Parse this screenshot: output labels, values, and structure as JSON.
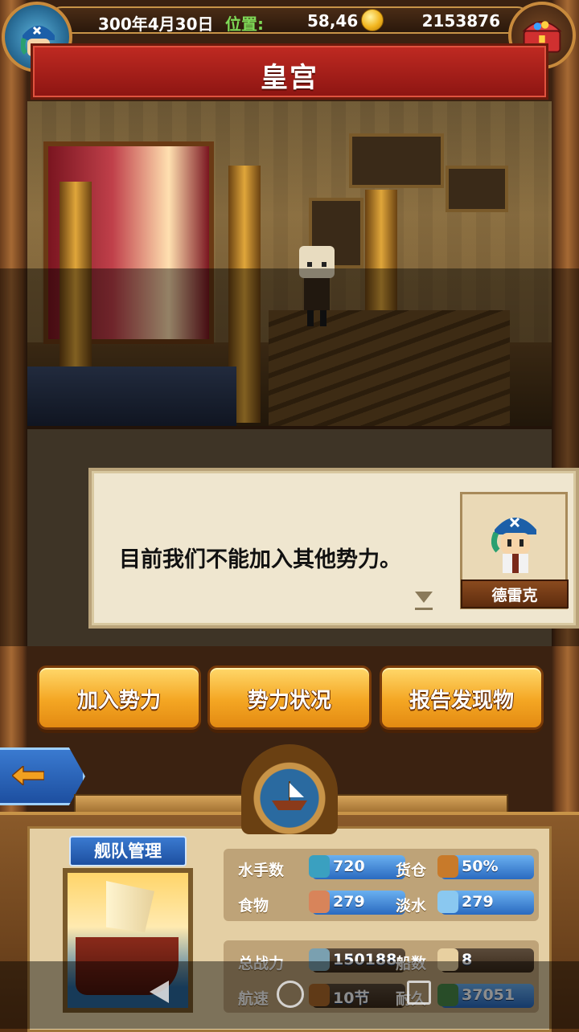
{
  "status_bar": {
    "date": "300年4月30日",
    "position_label": "位置:",
    "position_value": "58,46",
    "gold": "2153876",
    "coin_icon": "gold-coin-icon",
    "avatar_icon": "pirate-avatar-icon",
    "treasure_icon": "treasure-chest-icon"
  },
  "location_title": "皇宫",
  "dialog": {
    "text": "目前我们不能加入其他势力。",
    "speaker_name": "德雷克",
    "continue_icon": "down-triangle-icon"
  },
  "actions": {
    "join_faction": "加入势力",
    "faction_status": "势力状况",
    "report_discovery": "报告发现物"
  },
  "fleet": {
    "label": "舰队管理",
    "stats": {
      "sailors_label": "水手数",
      "sailors_value": "720",
      "cargo_label": "货仓",
      "cargo_value": "50%",
      "food_label": "食物",
      "food_value": "279",
      "water_label": "淡水",
      "water_value": "279",
      "power_label": "总战力",
      "power_value": "150188",
      "ships_label": "船数",
      "ships_value": "8",
      "speed_label": "航速",
      "speed_value": "10节",
      "durability_label": "耐久",
      "durability_value": "37051"
    }
  },
  "colors": {
    "title_red": "#c02a22",
    "button_orange": "#f4a623",
    "accent_blue": "#2a6ac0",
    "position_green": "#7ed957"
  }
}
